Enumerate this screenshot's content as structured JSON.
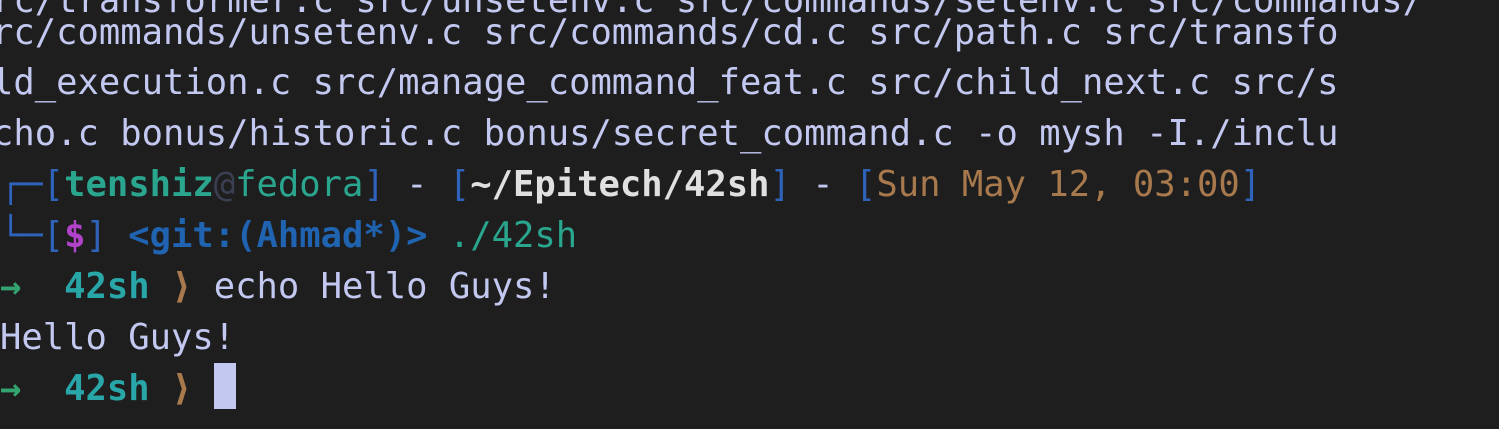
{
  "terminal": {
    "output_lines": [
      "rc/transformer.c src/unsetenv.c src/commands/setenv.c src/commands/",
      "rc/commands/unsetenv.c src/commands/cd.c src/path.c src/transfo",
      "ld_execution.c src/manage_command_feat.c src/child_next.c src/s",
      "cho.c bonus/historic.c bonus/secret_command.c -o mysh -I./inclu"
    ],
    "prompt": {
      "frame_top": "┌─",
      "frame_bottom": "└─",
      "open_bracket": "[",
      "close_bracket": "]",
      "user": "tenshiz",
      "at": "@",
      "host": "fedora",
      "separator": " - ",
      "path": "~/Epitech/42sh",
      "datetime": "Sun May 12, 03:00",
      "dollar": "$",
      "git": "<git:(Ahmad*)>",
      "command": "./42sh"
    },
    "shell": {
      "arrow": "→",
      "name": "42sh",
      "chevron": "⟩",
      "command_1": "echo Hello Guys!",
      "output_1": "Hello Guys!"
    }
  }
}
